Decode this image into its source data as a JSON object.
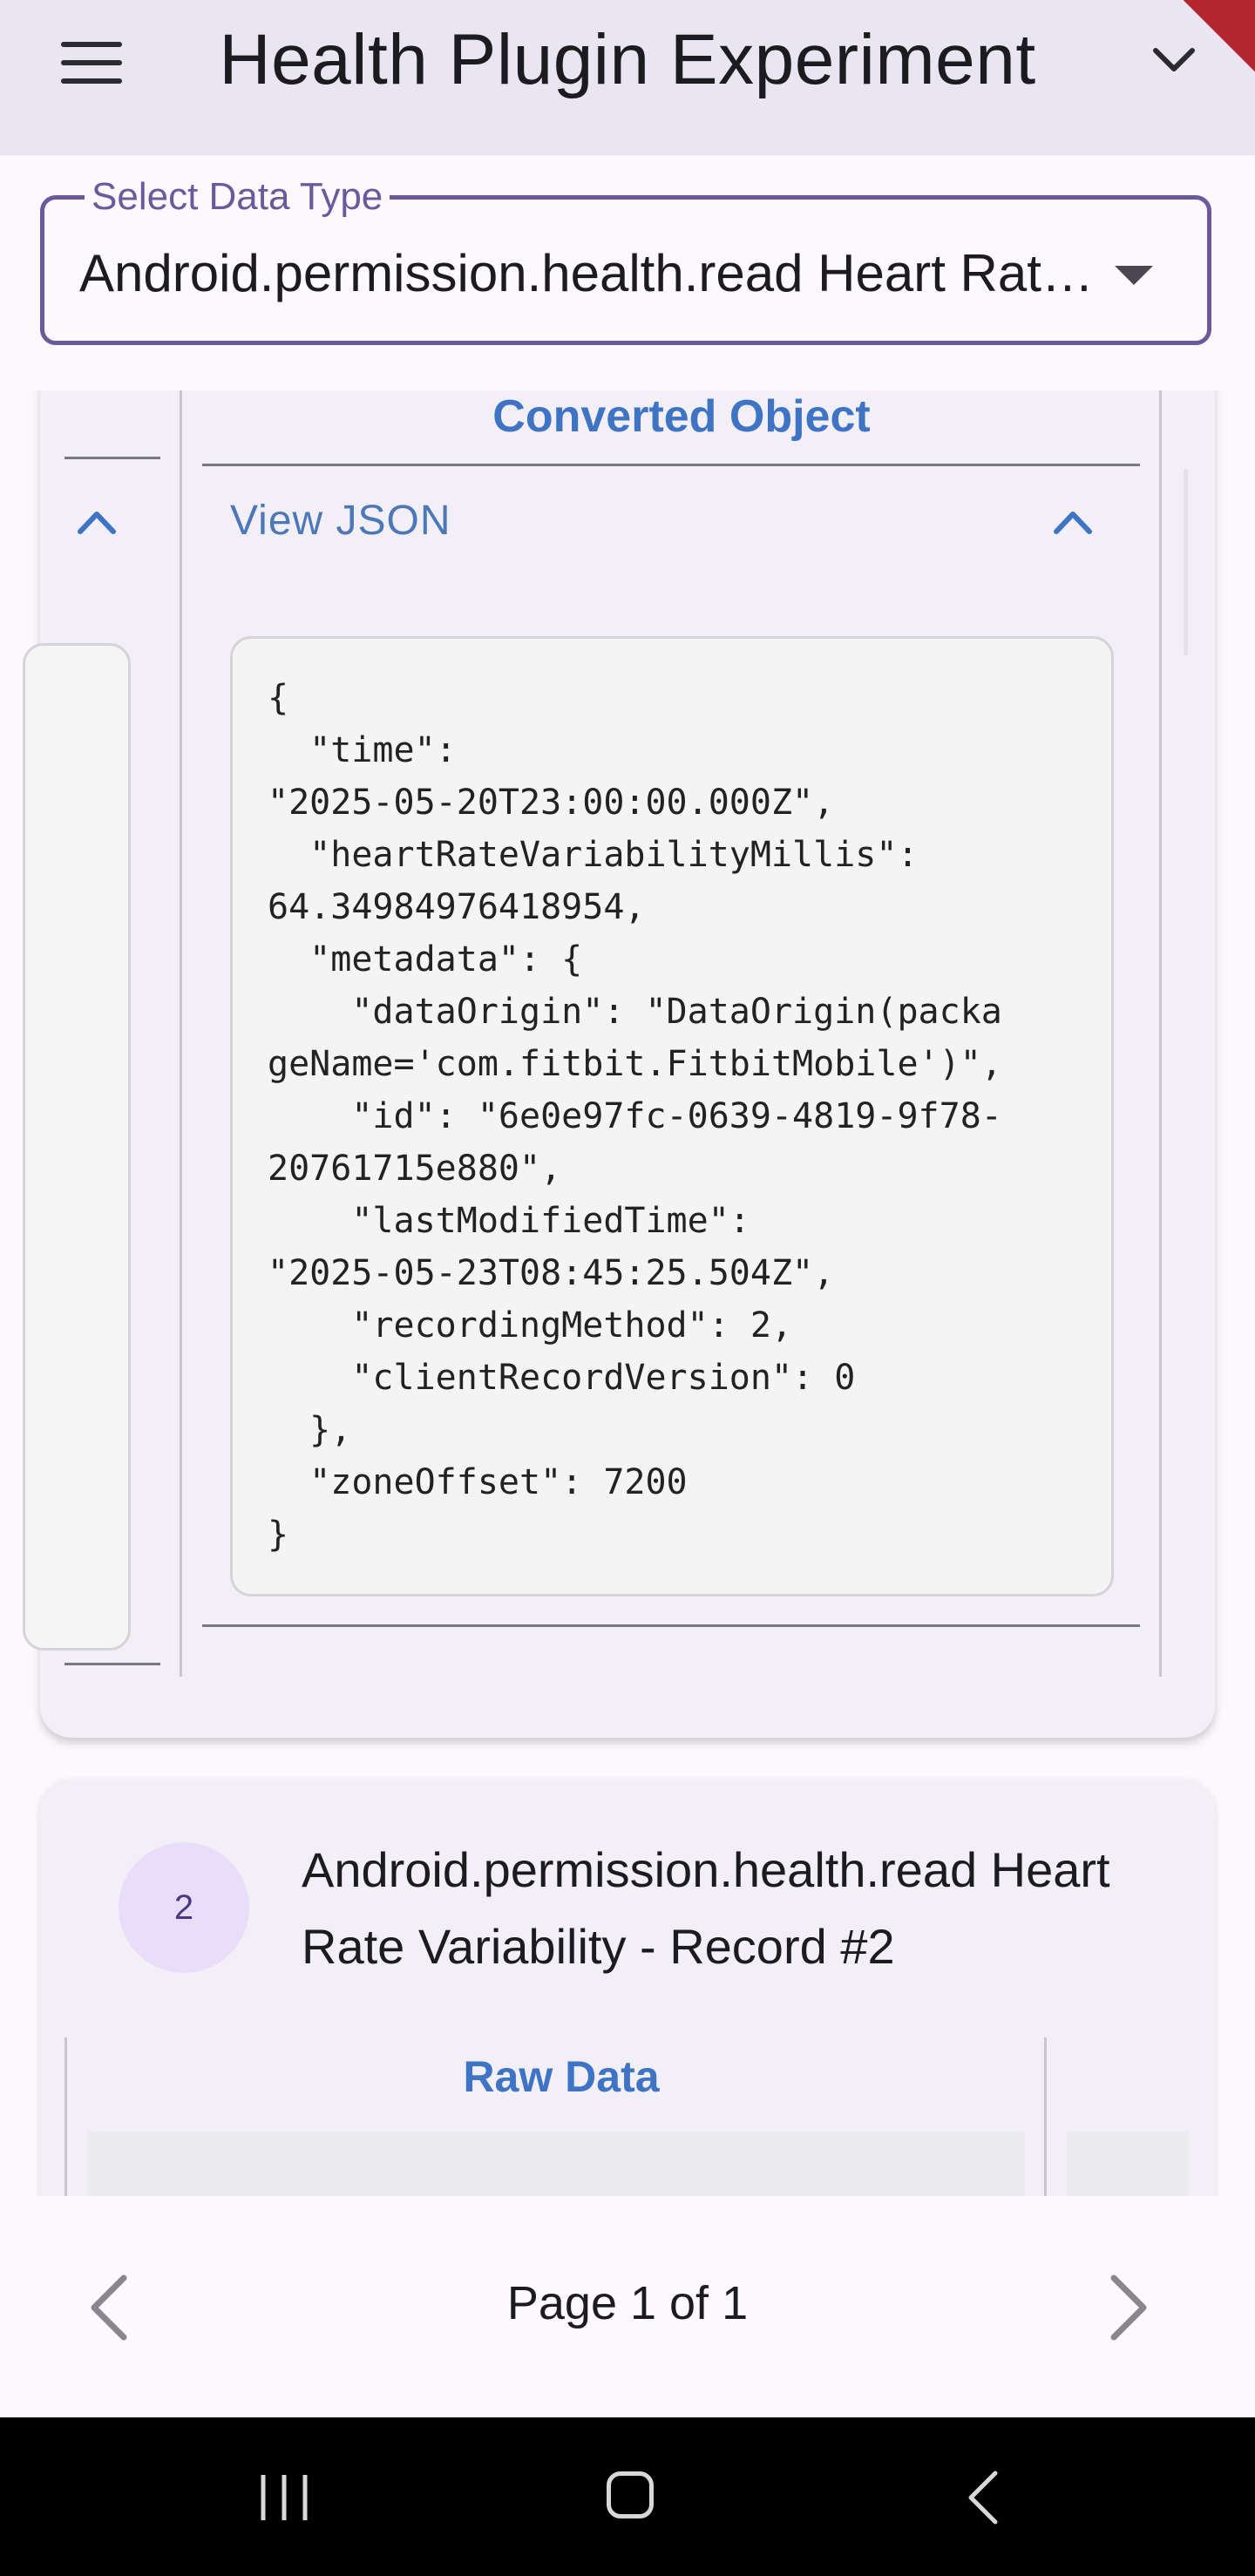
{
  "app_bar": {
    "title": "Health Plugin Experiment"
  },
  "data_type_select": {
    "label": "Select Data Type",
    "value": "Android.permission.health.read Heart Rate Variability"
  },
  "record_1": {
    "converted_title": "Converted Object",
    "view_json_label": "View JSON",
    "json_text": "{\n  \"time\":\n\"2025-05-20T23:00:00.000Z\",\n  \"heartRateVariabilityMillis\":\n64.34984976418954,\n  \"metadata\": {\n    \"dataOrigin\": \"DataOrigin(packa\ngeName='com.fitbit.FitbitMobile')\",\n    \"id\": \"6e0e97fc-0639-4819-9f78-\n20761715e880\",\n    \"lastModifiedTime\":\n\"2025-05-23T08:45:25.504Z\",\n    \"recordingMethod\": 2,\n    \"clientRecordVersion\": 0\n  },\n  \"zoneOffset\": 7200\n}"
  },
  "record_2": {
    "number": "2",
    "title": "Android.permission.health.read Heart Rate Variability - Record #2",
    "raw_title": "Raw Data"
  },
  "pagination": {
    "label": "Page 1 of 1"
  },
  "colors": {
    "accent": "#6a5a9b",
    "link": "#3f74c5",
    "app_bar": "#e9e5f1"
  }
}
